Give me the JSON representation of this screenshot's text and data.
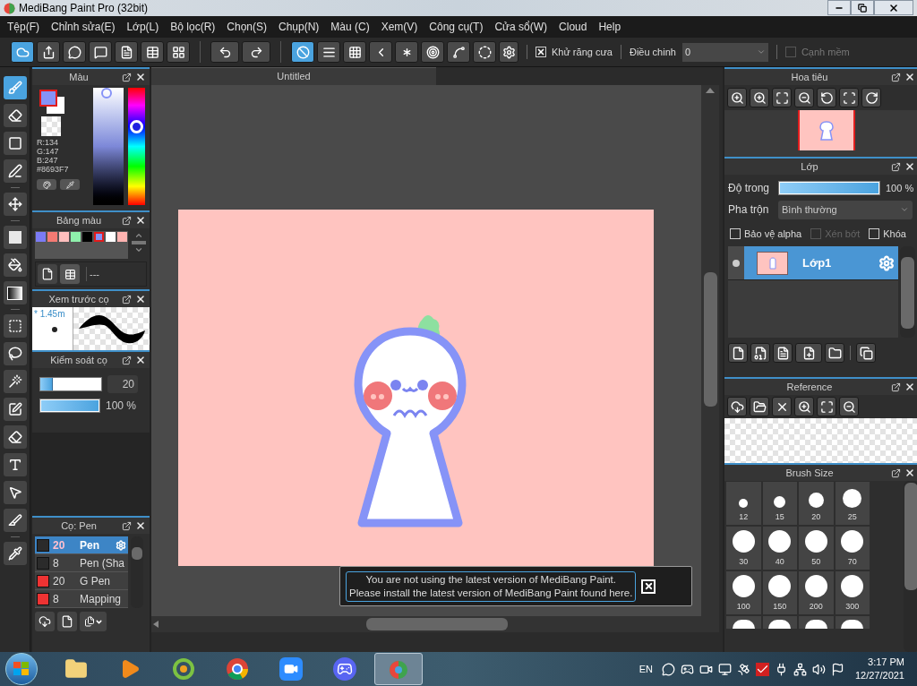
{
  "window": {
    "title": "MediBang Paint Pro (32bit)"
  },
  "menu": [
    "Tệp(F)",
    "Chỉnh sửa(E)",
    "Lớp(L)",
    "Bộ lọc(R)",
    "Chọn(S)",
    "Chụp(N)",
    "Màu (C)",
    "Xem(V)",
    "Công cụ(T)",
    "Cửa sổ(W)",
    "Cloud",
    "Help"
  ],
  "toolbar": {
    "rulers": [
      {
        "selected": true
      },
      {
        "selected": false
      },
      {
        "selected": false
      },
      {
        "selected": false
      },
      {
        "selected": false
      },
      {
        "selected": false
      },
      {
        "selected": false
      },
      {
        "selected": false
      }
    ],
    "antialias": {
      "label": "Khử răng cưa",
      "checked": true
    },
    "correction": {
      "label": "Điều chinh",
      "value": "0"
    },
    "soft_edge": {
      "label": "Cạnh mềm",
      "checked": false,
      "disabled": true
    }
  },
  "tools": [
    {
      "selected": true
    },
    {
      "selected": false
    },
    {
      "selected": false
    },
    {
      "selected": false
    },
    {
      "selected": false
    },
    {
      "selected": false
    },
    {
      "selected": false
    },
    {
      "selected": false
    },
    {
      "selected": false
    },
    {
      "selected": false
    },
    {
      "selected": false
    },
    {
      "selected": false
    },
    {
      "selected": false
    },
    {
      "selected": false
    },
    {
      "selected": false
    },
    {
      "selected": false
    },
    {
      "selected": false
    }
  ],
  "color_panel": {
    "title": "Màu",
    "foreground": {
      "color": "#8693f7"
    },
    "background": {
      "color": "#ffffff"
    },
    "r": "R:134",
    "g": "G:147",
    "b": "B:247",
    "hex": "#8693F7"
  },
  "palette": {
    "title": "Bảng màu",
    "name": "---",
    "swatches": [
      {
        "color": "#7b7bf5",
        "selected": false
      },
      {
        "color": "#f47a73",
        "selected": false
      },
      {
        "color": "#ffbfbe",
        "selected": false
      },
      {
        "color": "#8ff0ac",
        "selected": false
      },
      {
        "color": "#000000",
        "selected": false
      },
      {
        "color": "#8693f7",
        "selected": true
      },
      {
        "color": "#ffffff",
        "selected": false
      },
      {
        "color": "#ffb3b0",
        "selected": false
      }
    ]
  },
  "brush_preview": {
    "title": "Xem trước cọ",
    "size": "* 1.45m"
  },
  "brush_control": {
    "title": "Kiểm soát cọ",
    "size": {
      "level": 0.2,
      "value": "20"
    },
    "opacity": {
      "level": 1,
      "reading": "100 %"
    }
  },
  "brushes": {
    "title": "Cọ: Pen",
    "items": [
      {
        "size": "20",
        "name": "Pen",
        "color": "#2b2b2b",
        "selected": true
      },
      {
        "size": "8",
        "name": "Pen (Sha",
        "color": "#2b2b2b",
        "selected": false
      },
      {
        "size": "20",
        "name": "G Pen",
        "color": "#ee3333",
        "selected": false
      },
      {
        "size": "8",
        "name": "Mapping",
        "color": "#ee3333",
        "selected": false
      }
    ]
  },
  "canvas": {
    "tab": "Untitled"
  },
  "notice": {
    "lines": [
      "You are not using the latest version of MediBang Paint.",
      "Please install the latest version of MediBang Paint found here."
    ]
  },
  "navigator": {
    "title": "Hoa tiêu"
  },
  "layers": {
    "title": "Lớp",
    "opacity": {
      "label": "Độ trong",
      "level": 1,
      "reading": "100 %"
    },
    "blend": {
      "label": "Pha trộn",
      "value": "Bình thường"
    },
    "options": [
      {
        "label": "Bảo vệ alpha",
        "checked": false,
        "disabled": false
      },
      {
        "label": "Xén bớt",
        "checked": false,
        "disabled": true
      },
      {
        "label": "Khóa",
        "checked": false,
        "disabled": false
      }
    ],
    "items": [
      {
        "name": "Lớp1",
        "selected": true
      }
    ]
  },
  "reference": {
    "title": "Reference"
  },
  "brush_size": {
    "title": "Brush Size",
    "sizes": [
      "12",
      "15",
      "20",
      "25",
      "30",
      "40",
      "50",
      "70",
      "100",
      "150",
      "200",
      "300"
    ]
  },
  "taskbar": {
    "apps": [
      {
        "selected": false
      },
      {
        "selected": false
      },
      {
        "selected": false
      },
      {
        "selected": false
      },
      {
        "selected": false
      },
      {
        "selected": false
      },
      {
        "selected": true
      }
    ],
    "language": "EN",
    "time": "3:17 PM",
    "date": "12/27/2021"
  }
}
